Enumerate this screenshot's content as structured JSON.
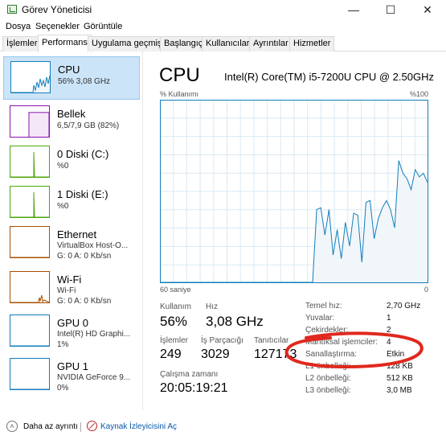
{
  "window": {
    "title": "Görev Yöneticisi",
    "minimize": "—",
    "maximize": "☐",
    "close": "✕"
  },
  "menu": [
    "Dosya",
    "Seçenekler",
    "Görüntüle"
  ],
  "tabs": [
    "İşlemler",
    "Performans",
    "Uygulama geçmişi",
    "Başlangıç",
    "Kullanıcılar",
    "Ayrıntılar",
    "Hizmetler"
  ],
  "active_tab": "Performans",
  "sidebar": [
    {
      "title": "CPU",
      "sub1": "56% 3,08 GHz",
      "sub2": "",
      "color": "#117dbb",
      "fill": "#f1f6fa",
      "level": 0.56
    },
    {
      "title": "Bellek",
      "sub1": "6,5/7,9 GB (82%)",
      "sub2": "",
      "color": "#8b12ae",
      "fill": "#f4e7f8",
      "level": 0.82
    },
    {
      "title": "0 Diski (C:)",
      "sub1": "%0",
      "sub2": "",
      "color": "#4da60c",
      "fill": "#eef7e6",
      "level": 0.0
    },
    {
      "title": "1 Diski (E:)",
      "sub1": "%0",
      "sub2": "",
      "color": "#4da60c",
      "fill": "#eef7e6",
      "level": 0.0
    },
    {
      "title": "Ethernet",
      "sub1": "VirtualBox Host-O...",
      "sub2": "G: 0 A: 0 Kb/sn",
      "color": "#a74f01",
      "fill": "#fcf3eb",
      "level": 0.0
    },
    {
      "title": "Wi-Fi",
      "sub1": "Wi-Fi",
      "sub2": "G: 0 A: 0 Kb/sn",
      "color": "#a74f01",
      "fill": "#fcf3eb",
      "level": 0.05
    },
    {
      "title": "GPU 0",
      "sub1": "Intel(R) HD Graphi...",
      "sub2": "1%",
      "color": "#117dbb",
      "fill": "#f1f6fa",
      "level": 0.01
    },
    {
      "title": "GPU 1",
      "sub1": "NVIDIA GeForce 9...",
      "sub2": "0%",
      "color": "#117dbb",
      "fill": "#f1f6fa",
      "level": 0.0
    }
  ],
  "main": {
    "title": "CPU",
    "cpu_name": "Intel(R) Core(TM) i5-7200U CPU @ 2.50GHz",
    "y_label": "% Kullanımı",
    "y_max_label": "%100",
    "x_left_label": "60 saniye",
    "x_right_label": "0"
  },
  "stats": {
    "usage_label": "Kullanım",
    "usage_value": "56%",
    "speed_label": "Hız",
    "speed_value": "3,08 GHz",
    "processes_label": "İşlemler",
    "processes_value": "249",
    "threads_label": "İş Parçacığı",
    "threads_value": "3029",
    "handles_label": "Tanıtıcılar",
    "handles_value": "127173",
    "uptime_label": "Çalışma zamanı",
    "uptime_value": "20:05:19:21"
  },
  "info": [
    {
      "key": "Temel hız:",
      "value": "2,70 GHz"
    },
    {
      "key": "Yuvalar:",
      "value": "1"
    },
    {
      "key": "Çekirdekler:",
      "value": "2"
    },
    {
      "key": "Mantıksal işlemciler:",
      "value": "4"
    },
    {
      "key": "Sanallaştırma:",
      "value": "Etkin"
    },
    {
      "key": "L1 önbelleği:",
      "value": "128 KB"
    },
    {
      "key": "L2 önbelleği:",
      "value": "512 KB"
    },
    {
      "key": "L3 önbelleği:",
      "value": "3,0 MB"
    }
  ],
  "footer": {
    "fewer_details": "Daha az ayrıntı",
    "resource_monitor": "Kaynak İzleyicisini Aç"
  },
  "colors": {
    "cpu_line": "#117dbb",
    "cpu_fill": "#f1f6fa",
    "grid": "#d9eaf4",
    "annotation": "#e0281e"
  },
  "chart_data": {
    "type": "line",
    "y_range": [
      0,
      100
    ],
    "x_range_seconds": [
      60,
      0
    ],
    "cpu_usage": [
      0,
      0,
      0,
      0,
      0,
      0,
      0,
      0,
      0,
      0,
      0,
      0,
      0,
      0,
      0,
      0,
      0,
      0,
      0,
      0,
      0,
      0,
      0,
      0,
      0,
      0,
      0,
      0,
      0,
      0,
      0,
      0,
      0,
      0,
      0,
      0,
      0,
      0,
      40,
      41,
      26,
      40,
      15,
      29,
      13,
      33,
      20,
      38,
      37,
      11,
      44,
      45,
      24,
      35,
      41,
      45,
      40,
      30,
      67,
      60,
      57,
      51,
      62,
      58,
      60,
      55
    ]
  }
}
